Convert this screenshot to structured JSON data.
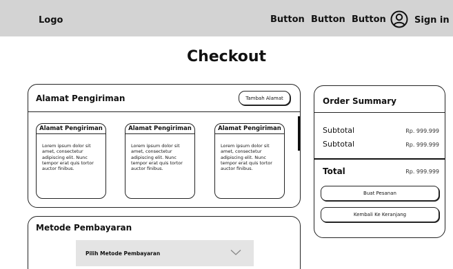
{
  "header": {
    "logo": "Logo",
    "nav_buttons": [
      "Button",
      "Button",
      "Button"
    ],
    "sign_in": "Sign in",
    "background": "#d3d3d3"
  },
  "page": {
    "title": "Checkout"
  },
  "shipping": {
    "title": "Alamat Pengiriman",
    "add_button": "Tambah Alamat",
    "addresses": [
      {
        "title": "Alamat Pengiriman",
        "text": "Lorem ipsum dolor sit amet, consectetur adipiscing elit. Nunc tempor erat quis tortor auctor finibus."
      },
      {
        "title": "Alamat Pengiriman",
        "text": "Lorem ipsum dolor sit amet, consectetur adipiscing elit. Nunc tempor erat quis tortor auctor finibus."
      },
      {
        "title": "Alamat Pengiriman",
        "text": "Lorem ipsum dolor sit amet, consectetur adipiscing elit. Nunc tempor erat quis tortor auctor finibus."
      }
    ]
  },
  "payment": {
    "title": "Metode Pembayaran",
    "select_label": "Pilih Metode Pembayaran",
    "select_icon": "chevron-down-icon"
  },
  "summary": {
    "title": "Order Summary",
    "rows": [
      {
        "label": "Subtotal",
        "value": "Rp. 999.999"
      },
      {
        "label": "Subtotal",
        "value": "Rp. 999.999"
      }
    ],
    "total_label": "Total",
    "total_value": "Rp. 999.999",
    "buy_button": "Buat Pesanan",
    "back_button": "Kembali Ke Keranjang"
  }
}
